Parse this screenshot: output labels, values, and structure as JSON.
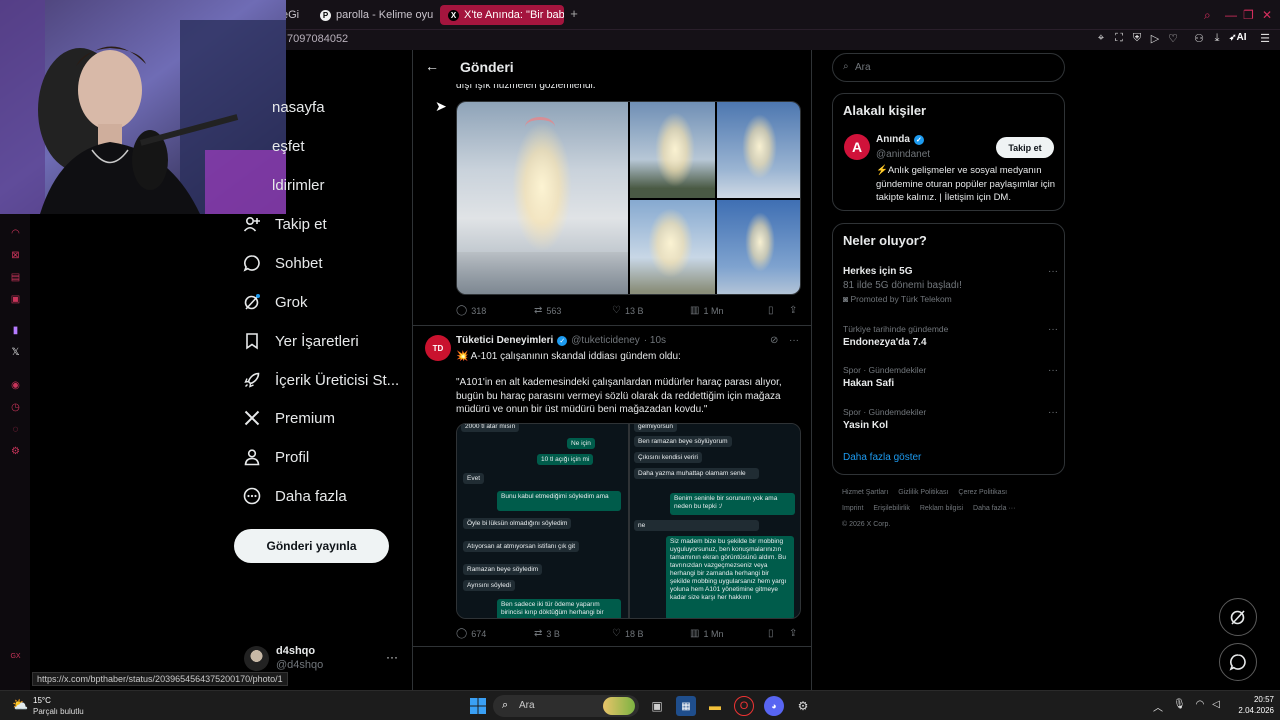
{
  "browser": {
    "tabs": [
      {
        "label": "eGi",
        "favicon": ""
      },
      {
        "label": "parolla - Kelime oyunu. G",
        "favicon": "P"
      },
      {
        "label": "X'te Anında: \"Bir baba, oğ",
        "favicon": "X"
      }
    ],
    "url_fragment": "7097084052",
    "ai_label": "AI"
  },
  "nav": {
    "items": [
      {
        "label": "nasayfa",
        "icon": "home-icon"
      },
      {
        "label": "eşfet",
        "icon": "explore-icon"
      },
      {
        "label": "ldirimler",
        "icon": "bell-icon"
      },
      {
        "label": "Takip et",
        "icon": "follow-icon"
      },
      {
        "label": "Sohbet",
        "icon": "chat-icon"
      },
      {
        "label": "Grok",
        "icon": "grok-icon"
      },
      {
        "label": "Yer İşaretleri",
        "icon": "bookmark-icon"
      },
      {
        "label": "İçerik Üreticisi St...",
        "icon": "rocket-icon"
      },
      {
        "label": "Premium",
        "icon": "x-logo-icon"
      },
      {
        "label": "Profil",
        "icon": "person-icon"
      },
      {
        "label": "Daha fazla",
        "icon": "more-circle-icon"
      }
    ],
    "post_button": "Gönderi yayınla",
    "profile": {
      "name": "d4shqo",
      "handle": "@d4shqo"
    }
  },
  "main": {
    "title": "Gönderi",
    "prev_text_fragment": "dışı ışık huzmeleri gözlemlendi.",
    "post1_actions": {
      "replies": "318",
      "reposts": "563",
      "likes": "13 B",
      "views": "1 Mn"
    },
    "tweet": {
      "avatar_text": "TD",
      "name": "Tüketici Deneyimleri",
      "handle": "@tuketicideney",
      "time": "· 10s",
      "line1": "💥 A-101 çalışanının skandal iddiası gündem oldu:",
      "quote": "\"A101'in en alt kademesindeki çalışanlardan müdürler haraç parası alıyor, bugün bu haraç parasını vermeyi sözlü olarak da reddettiğim için mağaza müdürü ve onun bir üst müdürü beni mağazadan kovdu.\"",
      "actions": {
        "replies": "674",
        "reposts": "3 B",
        "likes": "18 B",
        "views": "1 Mn"
      }
    },
    "chat_left": [
      {
        "text": "2000 tl atar mısın",
        "dir": "in"
      },
      {
        "text": "Ne için",
        "dir": "out"
      },
      {
        "text": "10 tl açığı için mi",
        "dir": "out"
      },
      {
        "text": "Evet",
        "dir": "in"
      },
      {
        "text": "Bunu kabul etmediğimi söyledim ama",
        "dir": "out"
      },
      {
        "text": "Öyle bi lüksün olmadığını söyledim",
        "dir": "in"
      },
      {
        "text": "Atıyorsan at atmıyorsan istifanı çık git",
        "dir": "in"
      },
      {
        "text": "Ramazan beye söyledim",
        "dir": "in"
      },
      {
        "text": "Ayrısını söyledi",
        "dir": "in"
      },
      {
        "text": "Ben sadece iki tür ödeme yaparım birincisi kırıp döktüğüm herhangi bir",
        "dir": "out"
      }
    ],
    "chat_right": [
      {
        "text": "gelmiyorsun",
        "dir": "in"
      },
      {
        "text": "Ben ramazan beye söylüyorum",
        "dir": "in"
      },
      {
        "text": "Çıkısını kendisi veriri",
        "dir": "in"
      },
      {
        "text": "Daha yazma muhattap olamam senle",
        "dir": "in"
      },
      {
        "text": "Benim seninle bir sorunum yok ama neden bu tepki :/",
        "dir": "out"
      },
      {
        "text": "ne",
        "dir": "in"
      },
      {
        "text": "Siz madem bize bu şekilde bir mobbing uyguluyorsunuz, ben konuşmalarınızın tamamının ekran görüntüsünü aldım. Bu tavrınızdan vazgeçmezseniz veya herhangi bir zamanda herhangi bir şekilde mobbing uygularsanız hem yargı yoluna hem A101 yönetimine gitmeye kadar size karşı her hakkımı",
        "dir": "out"
      }
    ]
  },
  "right": {
    "search_placeholder": "Ara",
    "related": {
      "title": "Alakalı kişiler",
      "avatar_letter": "A",
      "name": "Anında",
      "handle": "@anindanet",
      "follow": "Takip et",
      "bio": "⚡Anlık gelişmeler ve sosyal medyanın gündemine oturan popüler paylaşımlar için takipte kalınız. | İletişim için DM."
    },
    "trends": {
      "title": "Neler oluyor?",
      "items": [
        {
          "meta": "",
          "title": "Herkes için 5G",
          "sub": "81 ilde 5G dönemi başladı!",
          "promo": "Promoted by Türk Telekom"
        },
        {
          "meta": "Türkiye tarihinde gündemde",
          "title": "Endonezya'da 7.4",
          "sub": "",
          "promo": ""
        },
        {
          "meta": "Spor · Gündemdekiler",
          "title": "Hakan Safi",
          "sub": "",
          "promo": ""
        },
        {
          "meta": "Spor · Gündemdekiler",
          "title": "Yasin Kol",
          "sub": "",
          "promo": ""
        }
      ],
      "show_more": "Daha fazla göster"
    },
    "footer": {
      "line1": [
        "Hizmet Şartları",
        "Gizlilik Politikası",
        "Çerez Politikası"
      ],
      "line2": [
        "Imprint",
        "Erişilebilirlik",
        "Reklam bilgisi",
        "Daha fazla ···"
      ],
      "line3": "© 2026 X Corp."
    }
  },
  "statusbar": "https://x.com/bpthaber/status/2039654564375200170/photo/1",
  "taskbar": {
    "temp": "15°C",
    "condition": "Parçalı bulutlu",
    "search": "Ara",
    "time": "20:57",
    "date": "2.04.2026"
  },
  "colors": {
    "accent": "#1d9bf0",
    "tab_active": "#a4153e",
    "background": "#000000"
  }
}
